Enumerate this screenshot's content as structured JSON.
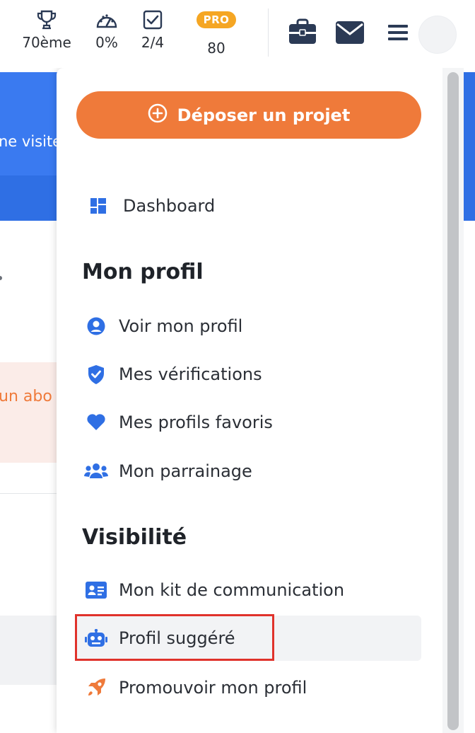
{
  "topbar": {
    "stats": [
      {
        "icon": "trophy-icon",
        "value": "70ème"
      },
      {
        "icon": "gauge-icon",
        "value": "0%"
      },
      {
        "icon": "checkbox-icon",
        "value": "2/4"
      },
      {
        "icon": "pro-badge",
        "badge": "PRO",
        "value": "80"
      }
    ],
    "icons": [
      "briefcase-icon",
      "envelope-icon",
      "hamburger-menu-icon"
    ]
  },
  "background": {
    "banner_fragment": "ne visite",
    "alert_fragment": "un abo"
  },
  "dropdown": {
    "cta_label": "Déposer un projet",
    "cta_icon": "plus-circle-icon",
    "dashboard": {
      "label": "Dashboard",
      "icon": "dashboard-grid-icon"
    },
    "sections": [
      {
        "title": "Mon profil",
        "items": [
          {
            "label": "Voir mon profil",
            "icon": "user-circle-icon"
          },
          {
            "label": "Mes vérifications",
            "icon": "shield-check-icon"
          },
          {
            "label": "Mes profils favoris",
            "icon": "heart-icon"
          },
          {
            "label": "Mon parrainage",
            "icon": "users-group-icon"
          }
        ]
      },
      {
        "title": "Visibilité",
        "items": [
          {
            "label": "Mon kit de communication",
            "icon": "id-card-icon"
          },
          {
            "label": "Profil suggéré",
            "icon": "robot-icon"
          },
          {
            "label": "Promouvoir mon profil",
            "icon": "rocket-icon"
          }
        ]
      }
    ]
  },
  "colors": {
    "accent_orange": "#ef7a3a",
    "icon_blue": "#2f6fe4",
    "navy_icon": "#2b3a55",
    "pro_badge": "#f5a623",
    "highlight_red": "#e0322b"
  }
}
